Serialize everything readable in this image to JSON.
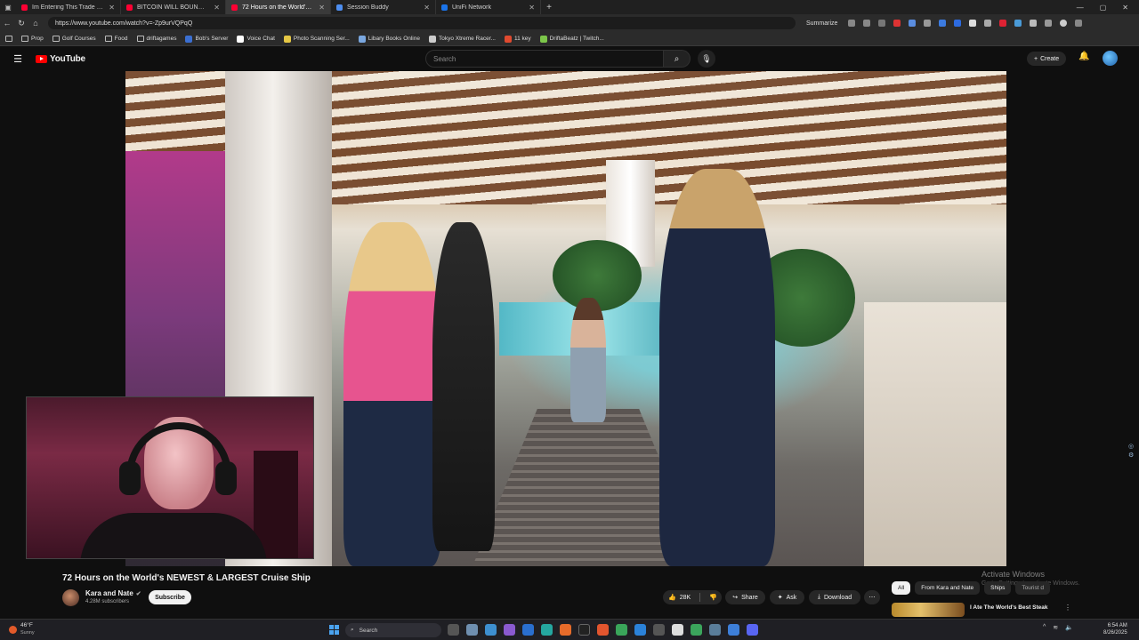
{
  "browser": {
    "tabs": [
      {
        "title": "Im Entering This Trade NOW...",
        "color": "#ff0033",
        "active": false
      },
      {
        "title": "BITCOIN WILL BOUNCE SOON AT...",
        "color": "#ff0033",
        "active": false
      },
      {
        "title": "72 Hours on the World's NE...",
        "color": "#ff0033",
        "active": true
      },
      {
        "title": "Session Buddy",
        "color": "#4d8ef0",
        "active": false
      },
      {
        "title": "UniFi Network",
        "color": "#1a73e8",
        "active": false
      }
    ],
    "url": "https://www.youtube.com/watch?v=-Zp9urVQPqQ",
    "summarize_label": "Summarize",
    "bookmarks": [
      {
        "label": "Prop",
        "kind": "folder"
      },
      {
        "label": "Golf Courses",
        "kind": "folder"
      },
      {
        "label": "Food",
        "kind": "folder"
      },
      {
        "label": "driftagames",
        "kind": "folder"
      },
      {
        "label": "Bob's Server",
        "kind": "site",
        "color": "#3b6fd1"
      },
      {
        "label": "Voice Chat",
        "kind": "site",
        "color": "#ffffff"
      },
      {
        "label": "Photo Scanning Ser...",
        "kind": "site",
        "color": "#e6c845"
      },
      {
        "label": "Libary Books Online",
        "kind": "site",
        "color": "#7aa7e0"
      },
      {
        "label": "Tokyo Xtreme Racer...",
        "kind": "site",
        "color": "#cccccc"
      },
      {
        "label": "11 key",
        "kind": "site",
        "color": "#e04a2f"
      },
      {
        "label": "DriftaBeatz | Twitch...",
        "kind": "site",
        "color": "#7cc64a"
      }
    ]
  },
  "youtube": {
    "logo_text": "YouTube",
    "search_placeholder": "Search",
    "create_label": "Create"
  },
  "video": {
    "title": "72 Hours on the World's NEWEST & LARGEST Cruise Ship",
    "channel_name": "Kara and Nate",
    "subscribers": "4.28M subscribers",
    "subscribe_label": "Subscribe",
    "likes": "28K",
    "share_label": "Share",
    "ask_label": "Ask",
    "download_label": "Download"
  },
  "chips": [
    {
      "label": "All",
      "active": true
    },
    {
      "label": "From Kara and Nate",
      "active": false
    },
    {
      "label": "Ships",
      "active": false
    },
    {
      "label": "Tourist d",
      "active": false
    }
  ],
  "recommendation": {
    "title": "I Ate The World's Best Steak"
  },
  "watermark": {
    "line1": "Activate Windows",
    "line2": "Go to Settings to activate Windows."
  },
  "taskbar": {
    "temperature": "46°F",
    "condition": "Sunny",
    "search_label": "Search",
    "time": "6:54 AM",
    "date": "8/26/2025"
  }
}
